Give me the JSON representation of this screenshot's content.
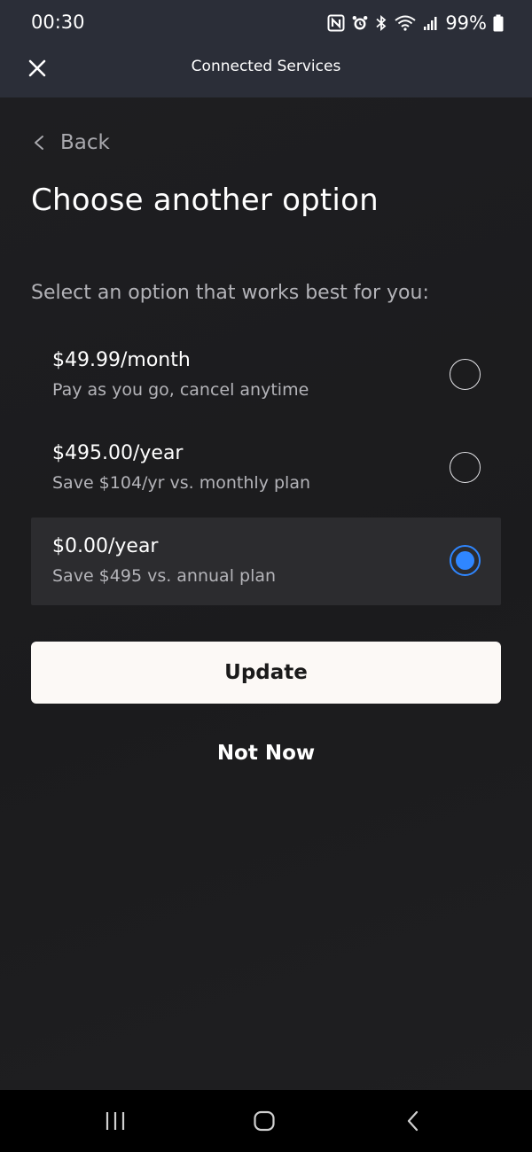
{
  "status_bar": {
    "time": "00:30",
    "battery_percent": "99%",
    "icons": [
      "nfc-icon",
      "alarm-icon",
      "bluetooth-icon",
      "wifi-icon",
      "signal-icon",
      "battery-icon"
    ]
  },
  "header": {
    "title": "Connected Services",
    "close_icon": "close-icon"
  },
  "back": {
    "label": "Back",
    "icon": "chevron-left-icon"
  },
  "page": {
    "title": "Choose another option",
    "subtitle": "Select an option that works best for you:"
  },
  "options": [
    {
      "price": "$49.99/month",
      "description": "Pay as you go, cancel anytime",
      "selected": false
    },
    {
      "price": "$495.00/year",
      "description": "Save $104/yr vs. monthly plan",
      "selected": false
    },
    {
      "price": "$0.00/year",
      "description": "Save $495 vs. annual plan",
      "selected": true
    }
  ],
  "actions": {
    "update_label": "Update",
    "not_now_label": "Not Now"
  },
  "nav_bar": {
    "icons": [
      "recent-apps-icon",
      "home-icon",
      "back-icon"
    ]
  },
  "colors": {
    "accent": "#2f86ff",
    "header_bg": "#2b2e38",
    "page_bg": "#1c1c1e",
    "selected_row_bg": "#2c2c2f",
    "button_bg": "#fcf9f6"
  }
}
